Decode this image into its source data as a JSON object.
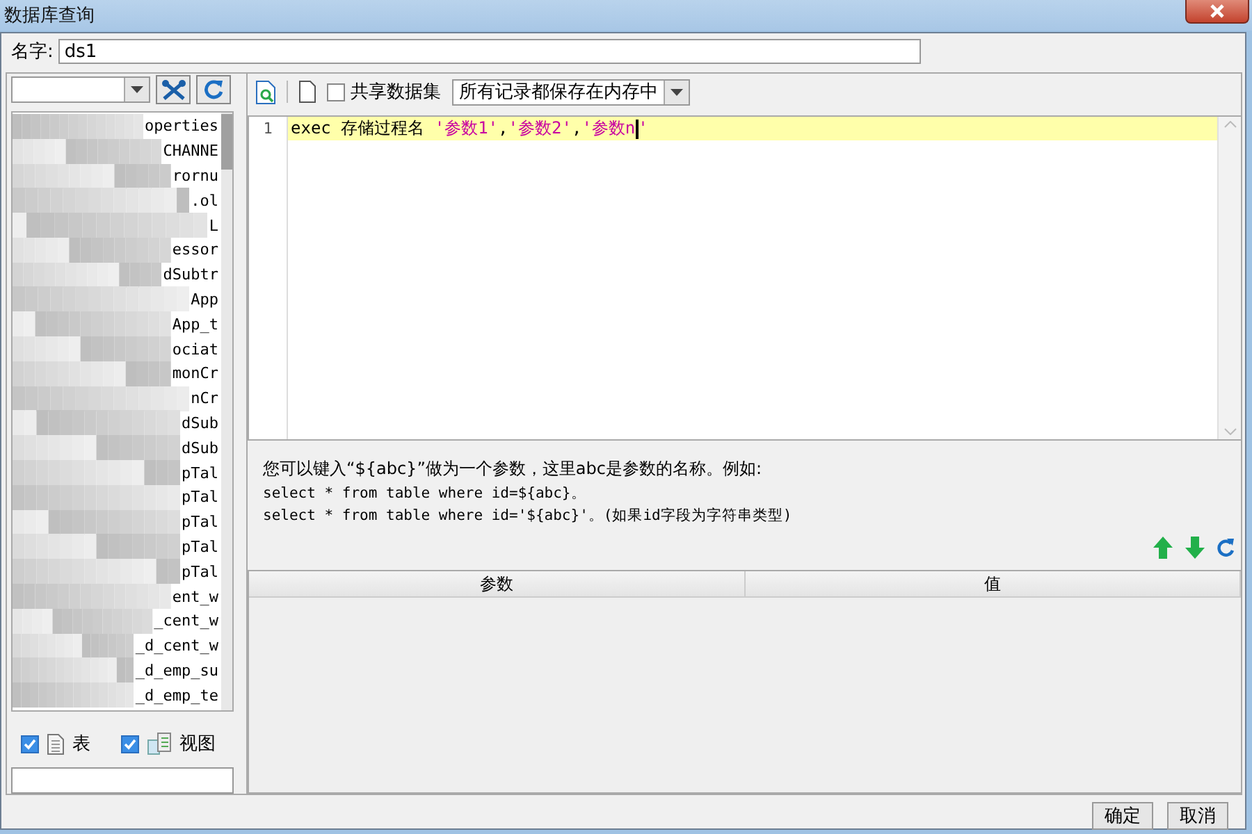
{
  "window": {
    "title": "数据库查询"
  },
  "name_field": {
    "label": "名字:",
    "value": "ds1"
  },
  "tree": {
    "items": [
      {
        "text": "operties"
      },
      {
        "text": "CHANNE"
      },
      {
        "text": "rornu"
      },
      {
        "text": ".ol"
      },
      {
        "text": "L"
      },
      {
        "text": "essor"
      },
      {
        "text": "dSubtr"
      },
      {
        "text": "App"
      },
      {
        "text": "App_t"
      },
      {
        "text": "ociat"
      },
      {
        "text": "monCr"
      },
      {
        "text": "nCr"
      },
      {
        "text": "dSub"
      },
      {
        "text": "dSub"
      },
      {
        "text": "pTal"
      },
      {
        "text": "pTal"
      },
      {
        "text": "pTal"
      },
      {
        "text": "pTal"
      },
      {
        "text": "pTal"
      },
      {
        "text": "ent_w"
      },
      {
        "text": "_cent_w"
      },
      {
        "text": "_d_cent_w"
      },
      {
        "text": "_d_emp_su"
      },
      {
        "text": "_d_emp_te"
      }
    ]
  },
  "filters": [
    {
      "label": "表",
      "checked": true,
      "kind": "table"
    },
    {
      "label": "视图",
      "checked": true,
      "kind": "view"
    }
  ],
  "toolbar": {
    "share": {
      "label": "共享数据集",
      "checked": false
    },
    "storage": {
      "value": "所有记录都保存在内存中"
    }
  },
  "editor": {
    "lines": [
      {
        "number": "1",
        "segments": [
          {
            "kind": "plain",
            "text": "exec 存储过程名 "
          },
          {
            "kind": "string",
            "text": "'参数1'"
          },
          {
            "kind": "plain",
            "text": ","
          },
          {
            "kind": "string",
            "text": "'参数2'"
          },
          {
            "kind": "plain",
            "text": ","
          },
          {
            "kind": "string",
            "text": "'参数n"
          },
          {
            "kind": "caret"
          },
          {
            "kind": "string",
            "text": "'"
          }
        ]
      }
    ]
  },
  "help": [
    "您可以键入“${abc}”做为一个参数，这里abc是参数的名称。例如:",
    "select * from table where id=${abc}。",
    "select * from table where id='${abc}'。(如果id字段为字符串类型)"
  ],
  "params_table": {
    "columns": [
      "参数",
      "值"
    ]
  },
  "buttons": [
    "确定",
    "取消"
  ]
}
